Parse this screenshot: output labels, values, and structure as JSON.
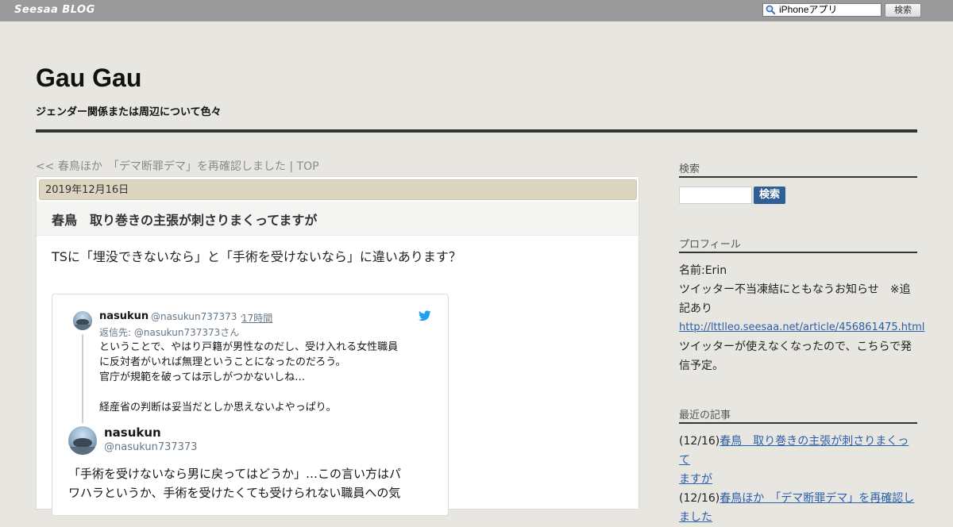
{
  "topbar": {
    "brand": "Seesaa BLOG",
    "search_value": "iPhoneアプリ",
    "search_button": "検索"
  },
  "header": {
    "title": "Gau Gau",
    "description": "ジェンダー関係または周辺について色々"
  },
  "nav": {
    "prev": "<< 春鳥ほか　「デマ断罪デマ」を再確認しました",
    "separator": " | ",
    "top": "TOP"
  },
  "article": {
    "date": "2019年12月16日",
    "title": "春鳥　取り巻きの主張が刺さりまくってますが",
    "lead": "TSに「埋没できないなら」と「手術を受けないなら」に違いあります？"
  },
  "tweet": {
    "reply": {
      "name": "nasukun",
      "handle": "@nasukun737373",
      "dot": "·",
      "time": "17時間",
      "reply_to": "返信先: @nasukun737373さん",
      "lines": [
        "ということで、やはり戸籍が男性なのだし、受け入れる女性職員",
        "に反対者がいれば無理ということになったのだろう。",
        "官庁が規範を破っては示しがつかないしね…",
        "",
        "経産省の判断は妥当だとしか思えないよやっぱり。"
      ]
    },
    "main": {
      "name": "nasukun",
      "handle": "@nasukun737373",
      "lines": [
        "「手術を受けないなら男に戻ってはどうか」…この言い方はパ",
        "ワハラというか、手術を受けたくても受けられない職員への気"
      ]
    }
  },
  "sidebar": {
    "search_heading": "検索",
    "search_button": "検索",
    "profile_heading": "プロフィール",
    "profile_name": "名前:Erin",
    "profile_note_1": "ツイッター不当凍結にともなうお知らせ　※追",
    "profile_note_2": "記あり",
    "profile_link": "http://lttlleo.seesaa.net/article/456861475.html",
    "profile_note_3": "ツイッターが使えなくなったので、こちらで発",
    "profile_note_4": "信予定。",
    "recent_heading": "最近の記事",
    "recent": [
      {
        "date": "(12/16)",
        "title_1": "春鳥　取り巻きの主張が刺さりまくって",
        "title_2": "ますが"
      },
      {
        "date": "(12/16)",
        "title_1": "春鳥ほか　「デマ断罪デマ」を再確認し",
        "title_2": "ました"
      }
    ]
  },
  "colors": {
    "topbar": "#9a9a9a",
    "page_bg": "#e8e6e1",
    "date_bar": "#dcd6c1",
    "link": "#2a5ea8",
    "search_button": "#2f5f94",
    "twitter_blue": "#1da1f2"
  },
  "icons": {
    "topbar_search": "magnifier-icon",
    "tweet_brand": "twitter-bird-icon"
  }
}
